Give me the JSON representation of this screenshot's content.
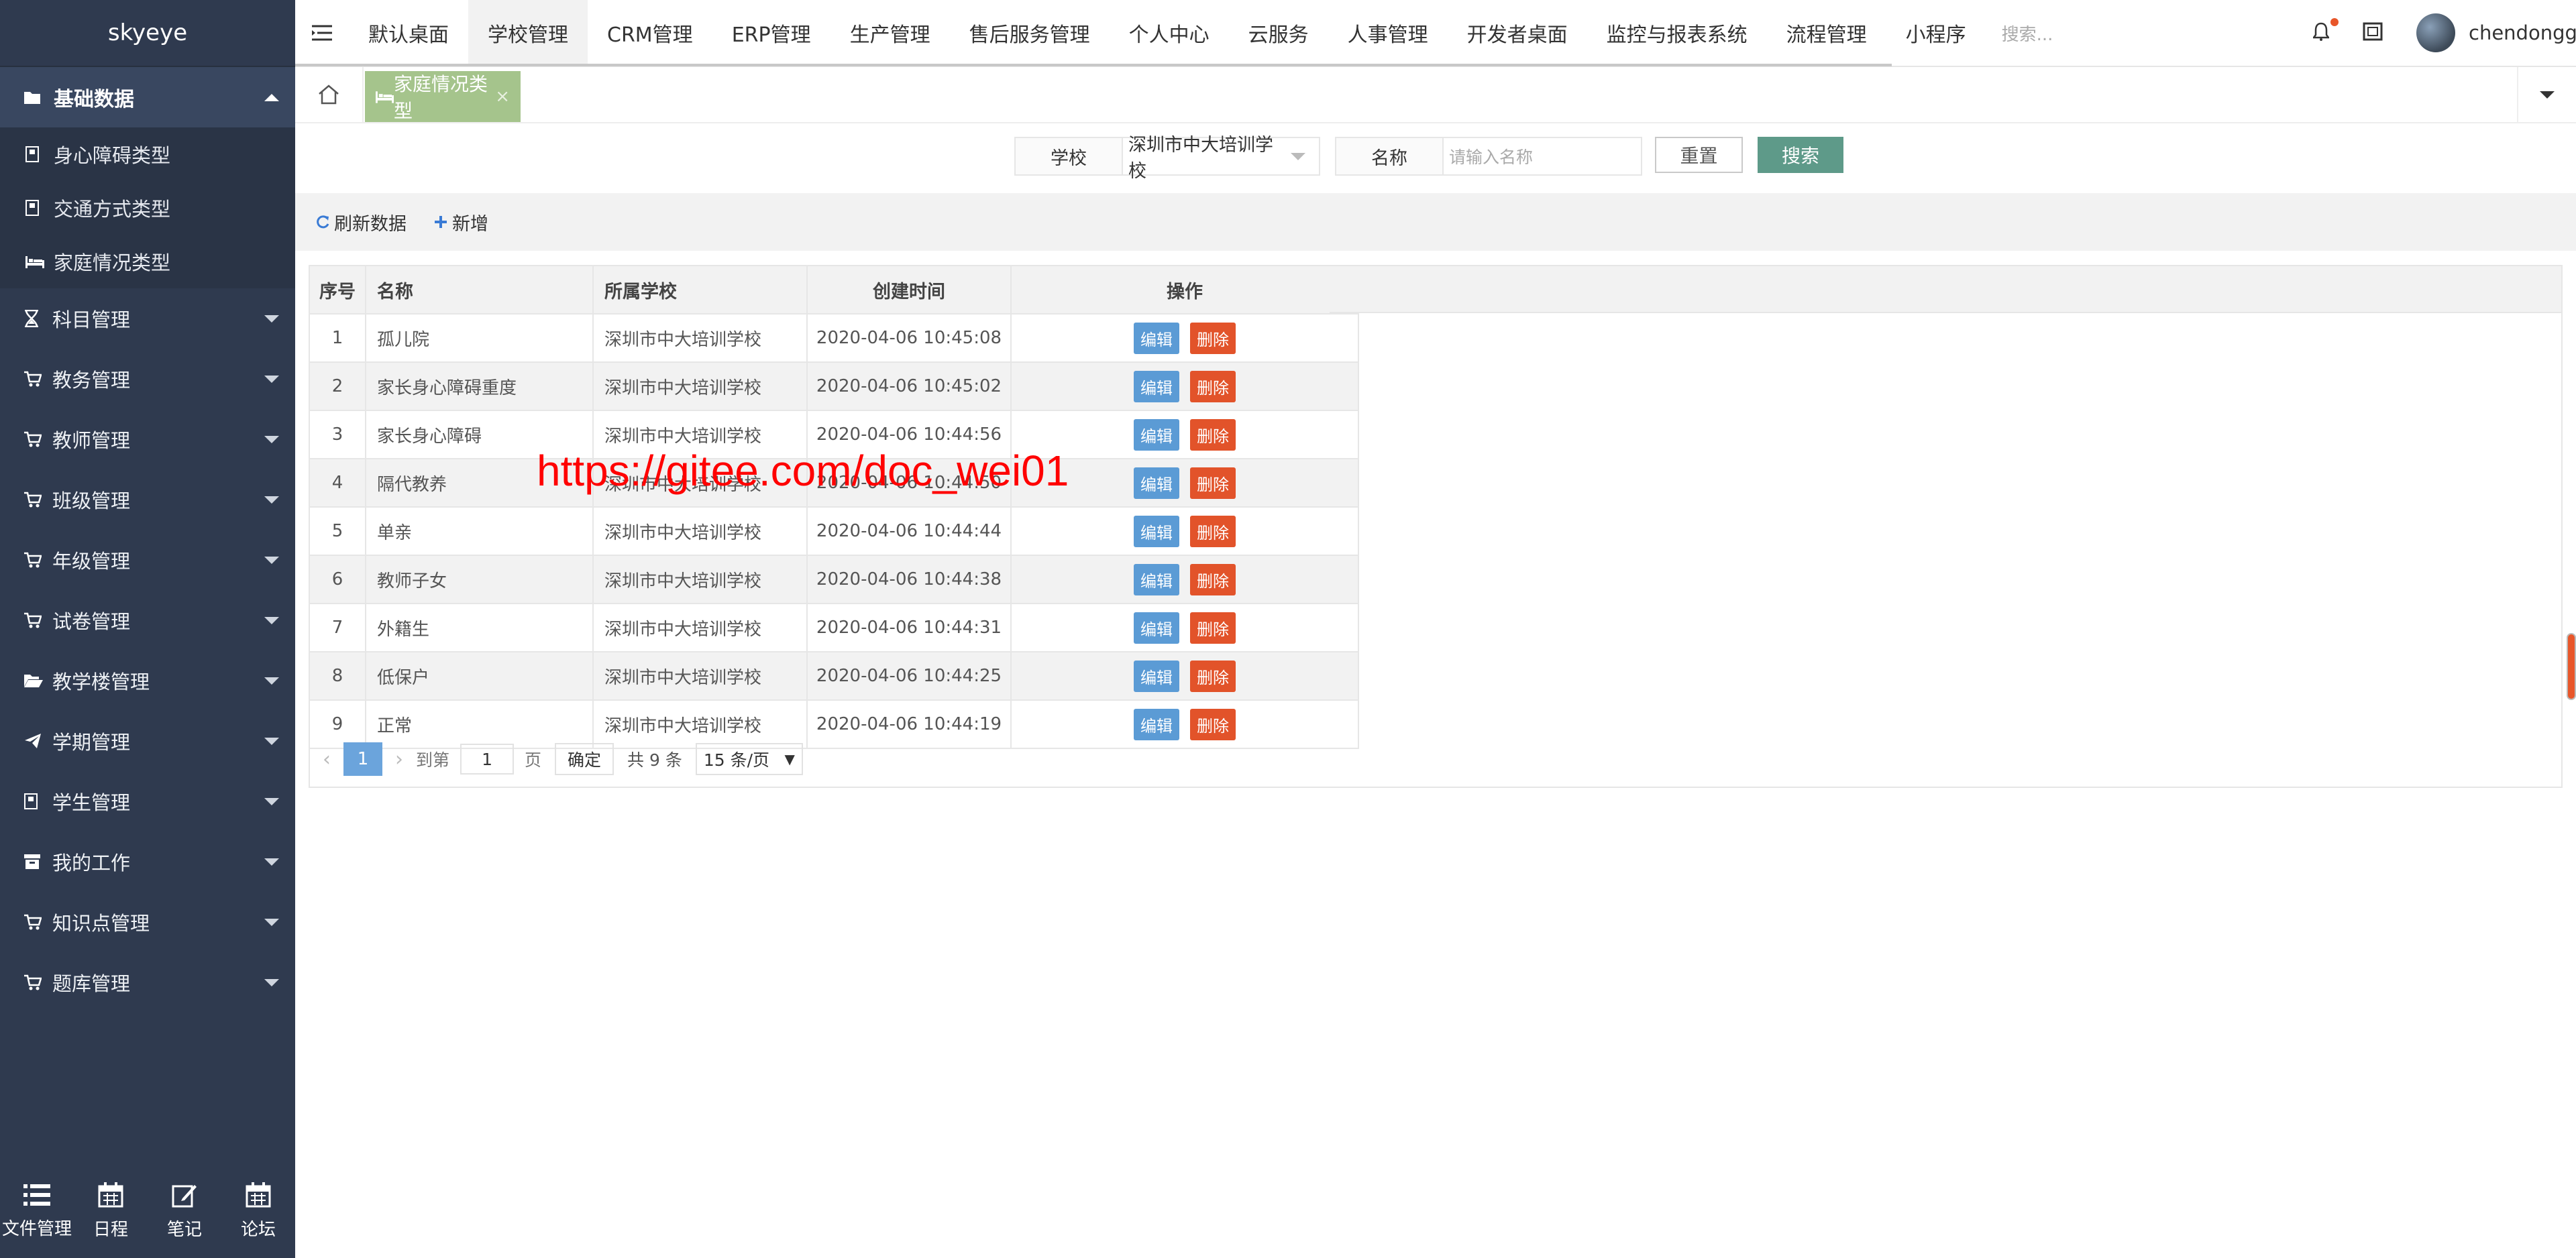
{
  "app": {
    "brand": "skyeye"
  },
  "sidebar": {
    "group": {
      "label": "基础数据",
      "items": [
        {
          "label": "身心障碍类型"
        },
        {
          "label": "交通方式类型"
        },
        {
          "label": "家庭情况类型"
        }
      ]
    },
    "items": [
      {
        "label": "科目管理",
        "icon": "hourglass-icon"
      },
      {
        "label": "教务管理",
        "icon": "cart-icon"
      },
      {
        "label": "教师管理",
        "icon": "cart-icon"
      },
      {
        "label": "班级管理",
        "icon": "cart-icon"
      },
      {
        "label": "年级管理",
        "icon": "cart-icon"
      },
      {
        "label": "试卷管理",
        "icon": "cart-icon"
      },
      {
        "label": "教学楼管理",
        "icon": "folder-open-icon"
      },
      {
        "label": "学期管理",
        "icon": "paper-plane-icon"
      },
      {
        "label": "学生管理",
        "icon": "id-card-icon"
      },
      {
        "label": "我的工作",
        "icon": "archive-icon"
      },
      {
        "label": "知识点管理",
        "icon": "cart-icon"
      },
      {
        "label": "题库管理",
        "icon": "cart-icon"
      }
    ],
    "bottom": [
      {
        "label": "文件管理",
        "icon": "list-icon"
      },
      {
        "label": "日程",
        "icon": "calendar-icon"
      },
      {
        "label": "笔记",
        "icon": "edit-icon"
      },
      {
        "label": "论坛",
        "icon": "calendar-icon"
      }
    ]
  },
  "topnav": {
    "tabs": [
      "默认桌面",
      "学校管理",
      "CRM管理",
      "ERP管理",
      "生产管理",
      "售后服务管理",
      "个人中心",
      "云服务",
      "人事管理",
      "开发者桌面",
      "监控与报表系统",
      "流程管理",
      "小程序"
    ],
    "active_tab": "学校管理",
    "search_placeholder": "搜索...",
    "username": "chendonggua"
  },
  "tabstrip": {
    "current_tab": "家庭情况类型",
    "close": "×"
  },
  "search": {
    "school_label": "学校",
    "school_value": "深圳市中大培训学校",
    "name_label": "名称",
    "name_placeholder": "请输入名称",
    "reset": "重置",
    "submit": "搜索"
  },
  "toolbar": {
    "refresh": "刷新数据",
    "add": "新增"
  },
  "table": {
    "headers": {
      "idx": "序号",
      "name": "名称",
      "school": "所属学校",
      "time": "创建时间",
      "op": "操作"
    },
    "edit": "编辑",
    "delete": "删除",
    "rows": [
      {
        "idx": "1",
        "name": "孤儿院",
        "school": "深圳市中大培训学校",
        "time": "2020-04-06 10:45:08"
      },
      {
        "idx": "2",
        "name": "家长身心障碍重度",
        "school": "深圳市中大培训学校",
        "time": "2020-04-06 10:45:02"
      },
      {
        "idx": "3",
        "name": "家长身心障碍",
        "school": "深圳市中大培训学校",
        "time": "2020-04-06 10:44:56"
      },
      {
        "idx": "4",
        "name": "隔代教养",
        "school": "深圳市中大培训学校",
        "time": "2020-04-06 10:44:50"
      },
      {
        "idx": "5",
        "name": "单亲",
        "school": "深圳市中大培训学校",
        "time": "2020-04-06 10:44:44"
      },
      {
        "idx": "6",
        "name": "教师子女",
        "school": "深圳市中大培训学校",
        "time": "2020-04-06 10:44:38"
      },
      {
        "idx": "7",
        "name": "外籍生",
        "school": "深圳市中大培训学校",
        "time": "2020-04-06 10:44:31"
      },
      {
        "idx": "8",
        "name": "低保户",
        "school": "深圳市中大培训学校",
        "time": "2020-04-06 10:44:25"
      },
      {
        "idx": "9",
        "name": "正常",
        "school": "深圳市中大培训学校",
        "time": "2020-04-06 10:44:19"
      }
    ]
  },
  "pagination": {
    "current": "1",
    "goto_prefix": "到第",
    "goto_value": "1",
    "goto_suffix": "页",
    "confirm": "确定",
    "total": "共 9 条",
    "page_size": "15 条/页"
  },
  "watermark": "https://gitee.com/doc_wei01"
}
